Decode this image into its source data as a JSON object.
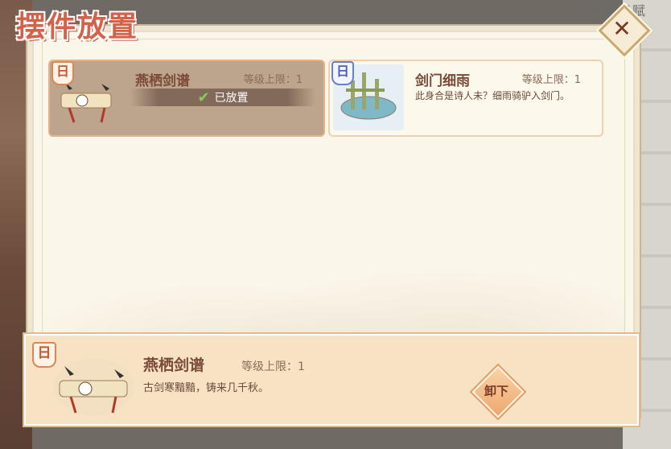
{
  "title": "摆件放置",
  "background": {
    "label": "技能天赋"
  },
  "items": [
    {
      "name": "燕栖剑谱",
      "level": "等级上限：1",
      "desc": "古剑寒黯黯，铸来几千秋。",
      "status": "已放置",
      "badge": "日",
      "selected": true
    },
    {
      "name": "剑门细雨",
      "level": "等级上限：1",
      "desc": "此身合是诗人未？细雨骑驴入剑门。",
      "badge": "日",
      "selected": false
    }
  ],
  "detail": {
    "badge": "日",
    "name": "燕栖剑谱",
    "level": "等级上限：1",
    "desc": "古剑寒黯黯，铸来几千秋。",
    "unequip_label": "卸下"
  },
  "colors": {
    "accent": "#d4624a",
    "panel": "#fbf6ea",
    "detail_bg": "#f7e2c4",
    "selected_bg": "#bda48d"
  }
}
